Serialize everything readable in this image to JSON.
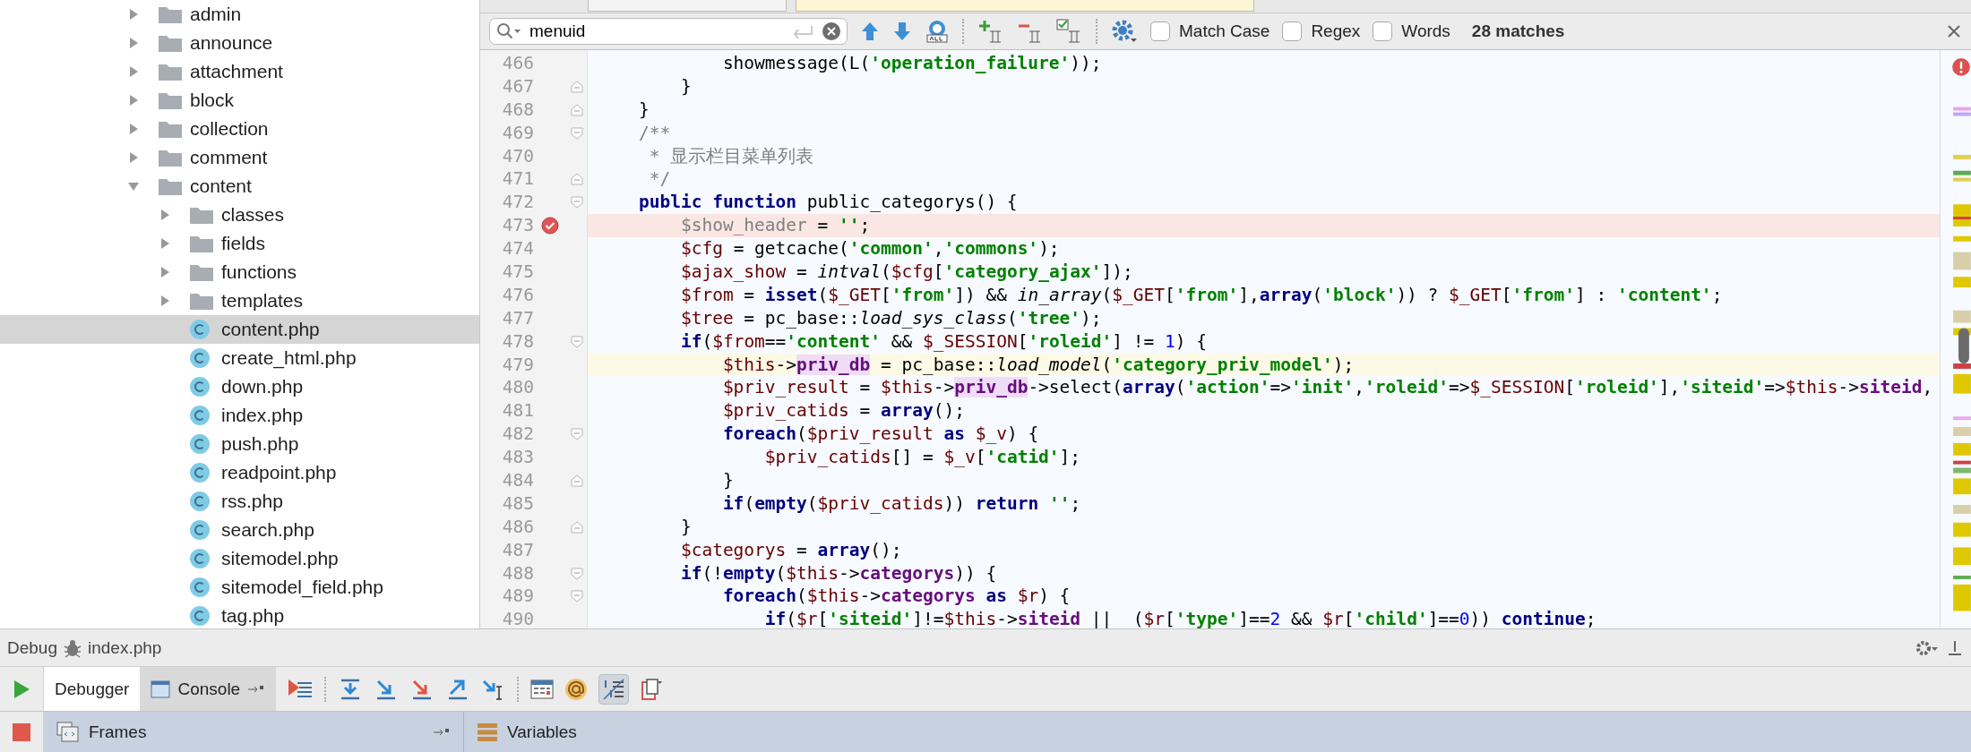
{
  "project_tree": [
    {
      "label": "admin",
      "kind": "folder",
      "expanded": false,
      "selected": false
    },
    {
      "label": "announce",
      "kind": "folder",
      "expanded": false,
      "selected": false
    },
    {
      "label": "attachment",
      "kind": "folder",
      "expanded": false,
      "selected": false
    },
    {
      "label": "block",
      "kind": "folder",
      "expanded": false,
      "selected": false
    },
    {
      "label": "collection",
      "kind": "folder",
      "expanded": false,
      "selected": false
    },
    {
      "label": "comment",
      "kind": "folder",
      "expanded": false,
      "selected": false
    },
    {
      "label": "content",
      "kind": "folder",
      "expanded": true,
      "selected": false,
      "children": [
        {
          "label": "classes",
          "kind": "folder",
          "expanded": false,
          "selected": false
        },
        {
          "label": "fields",
          "kind": "folder",
          "expanded": false,
          "selected": false
        },
        {
          "label": "functions",
          "kind": "folder",
          "expanded": false,
          "selected": false
        },
        {
          "label": "templates",
          "kind": "folder",
          "expanded": false,
          "selected": false
        },
        {
          "label": "content.php",
          "kind": "file",
          "selected": true
        },
        {
          "label": "create_html.php",
          "kind": "file",
          "selected": false
        },
        {
          "label": "down.php",
          "kind": "file",
          "selected": false
        },
        {
          "label": "index.php",
          "kind": "file",
          "selected": false
        },
        {
          "label": "push.php",
          "kind": "file",
          "selected": false
        },
        {
          "label": "readpoint.php",
          "kind": "file",
          "selected": false
        },
        {
          "label": "rss.php",
          "kind": "file",
          "selected": false
        },
        {
          "label": "search.php",
          "kind": "file",
          "selected": false
        },
        {
          "label": "sitemodel.php",
          "kind": "file",
          "selected": false
        },
        {
          "label": "sitemodel_field.php",
          "kind": "file",
          "selected": false
        },
        {
          "label": "tag.php",
          "kind": "file",
          "selected": false
        }
      ]
    }
  ],
  "search_bar": {
    "value": "menuid",
    "options": [
      {
        "label": "Match Case",
        "checked": false
      },
      {
        "label": "Regex",
        "checked": false
      },
      {
        "label": "Words",
        "checked": false
      }
    ],
    "matches": "28 matches"
  },
  "code_lines": [
    {
      "number": "466",
      "breakpoint": false,
      "execution_line": false,
      "fold_start": false,
      "fold_end": false,
      "tokens": [
        {
          "kind": "plain",
          "text": "            showmessage(L("
        },
        {
          "kind": "string",
          "text": "'operation_failure'"
        },
        {
          "kind": "plain",
          "text": "));"
        }
      ]
    },
    {
      "number": "467",
      "breakpoint": false,
      "execution_line": false,
      "fold_start": false,
      "fold_end": true,
      "tokens": [
        {
          "kind": "plain",
          "text": "        }"
        }
      ]
    },
    {
      "number": "468",
      "breakpoint": false,
      "execution_line": false,
      "fold_start": false,
      "fold_end": true,
      "tokens": [
        {
          "kind": "plain",
          "text": "    }"
        }
      ]
    },
    {
      "number": "469",
      "breakpoint": false,
      "execution_line": false,
      "fold_start": true,
      "fold_end": false,
      "tokens": [
        {
          "kind": "comment",
          "text": "    /**"
        }
      ]
    },
    {
      "number": "470",
      "breakpoint": false,
      "execution_line": false,
      "fold_start": false,
      "fold_end": false,
      "tokens": [
        {
          "kind": "comment",
          "text": "     * 显示栏目菜单列表"
        }
      ]
    },
    {
      "number": "471",
      "breakpoint": false,
      "execution_line": false,
      "fold_start": false,
      "fold_end": true,
      "tokens": [
        {
          "kind": "comment",
          "text": "     */"
        }
      ]
    },
    {
      "number": "472",
      "breakpoint": false,
      "execution_line": false,
      "fold_start": true,
      "fold_end": false,
      "tokens": [
        {
          "kind": "keyword",
          "text": "    public function "
        },
        {
          "kind": "plain",
          "text": "public_categorys() {"
        }
      ]
    },
    {
      "number": "473",
      "breakpoint": true,
      "execution_line": false,
      "fold_start": false,
      "fold_end": false,
      "tokens": [
        {
          "kind": "unused",
          "text": "        $show_header"
        },
        {
          "kind": "plain",
          "text": " = "
        },
        {
          "kind": "string",
          "text": "''"
        },
        {
          "kind": "plain",
          "text": ";"
        }
      ]
    },
    {
      "number": "474",
      "breakpoint": false,
      "execution_line": false,
      "fold_start": false,
      "fold_end": false,
      "tokens": [
        {
          "kind": "variable",
          "text": "        $cfg"
        },
        {
          "kind": "plain",
          "text": " = getcache("
        },
        {
          "kind": "string",
          "text": "'common'"
        },
        {
          "kind": "plain",
          "text": ","
        },
        {
          "kind": "string",
          "text": "'commons'"
        },
        {
          "kind": "plain",
          "text": ");"
        }
      ]
    },
    {
      "number": "475",
      "breakpoint": false,
      "execution_line": false,
      "fold_start": false,
      "fold_end": false,
      "tokens": [
        {
          "kind": "variable",
          "text": "        $ajax_show"
        },
        {
          "kind": "plain",
          "text": " = "
        },
        {
          "kind": "call",
          "text": "intval"
        },
        {
          "kind": "plain",
          "text": "("
        },
        {
          "kind": "variable",
          "text": "$cfg"
        },
        {
          "kind": "plain",
          "text": "["
        },
        {
          "kind": "string",
          "text": "'category_ajax'"
        },
        {
          "kind": "plain",
          "text": "]);"
        }
      ]
    },
    {
      "number": "476",
      "breakpoint": false,
      "execution_line": false,
      "fold_start": false,
      "fold_end": false,
      "tokens": [
        {
          "kind": "variable",
          "text": "        $from"
        },
        {
          "kind": "plain",
          "text": " = "
        },
        {
          "kind": "keyword",
          "text": "isset"
        },
        {
          "kind": "plain",
          "text": "("
        },
        {
          "kind": "variable",
          "text": "$_GET"
        },
        {
          "kind": "plain",
          "text": "["
        },
        {
          "kind": "string",
          "text": "'from'"
        },
        {
          "kind": "plain",
          "text": "]) && "
        },
        {
          "kind": "call",
          "text": "in_array"
        },
        {
          "kind": "plain",
          "text": "("
        },
        {
          "kind": "variable",
          "text": "$_GET"
        },
        {
          "kind": "plain",
          "text": "["
        },
        {
          "kind": "string",
          "text": "'from'"
        },
        {
          "kind": "plain",
          "text": "],"
        },
        {
          "kind": "keyword",
          "text": "array"
        },
        {
          "kind": "plain",
          "text": "("
        },
        {
          "kind": "string",
          "text": "'block'"
        },
        {
          "kind": "plain",
          "text": ")) ? "
        },
        {
          "kind": "variable",
          "text": "$_GET"
        },
        {
          "kind": "plain",
          "text": "["
        },
        {
          "kind": "string",
          "text": "'from'"
        },
        {
          "kind": "plain",
          "text": "] : "
        },
        {
          "kind": "string",
          "text": "'content'"
        },
        {
          "kind": "plain",
          "text": ";"
        }
      ]
    },
    {
      "number": "477",
      "breakpoint": false,
      "execution_line": false,
      "fold_start": false,
      "fold_end": false,
      "tokens": [
        {
          "kind": "variable",
          "text": "        $tree"
        },
        {
          "kind": "plain",
          "text": " = pc_base::"
        },
        {
          "kind": "call",
          "text": "load_sys_class"
        },
        {
          "kind": "plain",
          "text": "("
        },
        {
          "kind": "string",
          "text": "'tree'"
        },
        {
          "kind": "plain",
          "text": ");"
        }
      ]
    },
    {
      "number": "478",
      "breakpoint": false,
      "execution_line": false,
      "fold_start": true,
      "fold_end": false,
      "tokens": [
        {
          "kind": "keyword",
          "text": "        if"
        },
        {
          "kind": "plain",
          "text": "("
        },
        {
          "kind": "variable",
          "text": "$from"
        },
        {
          "kind": "plain",
          "text": "=="
        },
        {
          "kind": "string",
          "text": "'content'"
        },
        {
          "kind": "plain",
          "text": " && "
        },
        {
          "kind": "variable",
          "text": "$_SESSION"
        },
        {
          "kind": "plain",
          "text": "["
        },
        {
          "kind": "string",
          "text": "'roleid'"
        },
        {
          "kind": "plain",
          "text": "] != "
        },
        {
          "kind": "number",
          "text": "1"
        },
        {
          "kind": "plain",
          "text": ") {"
        }
      ]
    },
    {
      "number": "479",
      "breakpoint": false,
      "execution_line": true,
      "fold_start": false,
      "fold_end": false,
      "tokens": [
        {
          "kind": "variable",
          "text": "            $this"
        },
        {
          "kind": "plain",
          "text": "->"
        },
        {
          "kind": "marked_field",
          "text": "priv_db"
        },
        {
          "kind": "plain",
          "text": " = pc_base::"
        },
        {
          "kind": "call",
          "text": "load_model"
        },
        {
          "kind": "plain",
          "text": "("
        },
        {
          "kind": "string",
          "text": "'category_priv_model'"
        },
        {
          "kind": "plain",
          "text": ");"
        }
      ]
    },
    {
      "number": "480",
      "breakpoint": false,
      "execution_line": false,
      "fold_start": false,
      "fold_end": false,
      "tokens": [
        {
          "kind": "variable",
          "text": "            $priv_result"
        },
        {
          "kind": "plain",
          "text": " = "
        },
        {
          "kind": "variable",
          "text": "$this"
        },
        {
          "kind": "plain",
          "text": "->"
        },
        {
          "kind": "marked_field",
          "text": "priv_db"
        },
        {
          "kind": "plain",
          "text": "->select("
        },
        {
          "kind": "keyword",
          "text": "array"
        },
        {
          "kind": "plain",
          "text": "("
        },
        {
          "kind": "string",
          "text": "'action'"
        },
        {
          "kind": "plain",
          "text": "=>"
        },
        {
          "kind": "string",
          "text": "'init'"
        },
        {
          "kind": "plain",
          "text": ","
        },
        {
          "kind": "string",
          "text": "'roleid'"
        },
        {
          "kind": "plain",
          "text": "=>"
        },
        {
          "kind": "variable",
          "text": "$_SESSION"
        },
        {
          "kind": "plain",
          "text": "["
        },
        {
          "kind": "string",
          "text": "'roleid'"
        },
        {
          "kind": "plain",
          "text": "],"
        },
        {
          "kind": "string",
          "text": "'siteid'"
        },
        {
          "kind": "plain",
          "text": "=>"
        },
        {
          "kind": "variable",
          "text": "$this"
        },
        {
          "kind": "plain",
          "text": "->"
        },
        {
          "kind": "field",
          "text": "siteid"
        },
        {
          "kind": "plain",
          "text": ","
        }
      ]
    },
    {
      "number": "481",
      "breakpoint": false,
      "execution_line": false,
      "fold_start": false,
      "fold_end": false,
      "tokens": [
        {
          "kind": "variable",
          "text": "            $priv_catids"
        },
        {
          "kind": "plain",
          "text": " = "
        },
        {
          "kind": "keyword",
          "text": "array"
        },
        {
          "kind": "plain",
          "text": "();"
        }
      ]
    },
    {
      "number": "482",
      "breakpoint": false,
      "execution_line": false,
      "fold_start": true,
      "fold_end": false,
      "tokens": [
        {
          "kind": "keyword",
          "text": "            foreach"
        },
        {
          "kind": "plain",
          "text": "("
        },
        {
          "kind": "variable",
          "text": "$priv_result"
        },
        {
          "kind": "keyword",
          "text": " as "
        },
        {
          "kind": "variable",
          "text": "$_v"
        },
        {
          "kind": "plain",
          "text": ") {"
        }
      ]
    },
    {
      "number": "483",
      "breakpoint": false,
      "execution_line": false,
      "fold_start": false,
      "fold_end": false,
      "tokens": [
        {
          "kind": "variable",
          "text": "                $priv_catids"
        },
        {
          "kind": "plain",
          "text": "[] = "
        },
        {
          "kind": "variable",
          "text": "$_v"
        },
        {
          "kind": "plain",
          "text": "["
        },
        {
          "kind": "string",
          "text": "'catid'"
        },
        {
          "kind": "plain",
          "text": "];"
        }
      ]
    },
    {
      "number": "484",
      "breakpoint": false,
      "execution_line": false,
      "fold_start": false,
      "fold_end": true,
      "tokens": [
        {
          "kind": "plain",
          "text": "            }"
        }
      ]
    },
    {
      "number": "485",
      "breakpoint": false,
      "execution_line": false,
      "fold_start": false,
      "fold_end": false,
      "tokens": [
        {
          "kind": "keyword",
          "text": "            if"
        },
        {
          "kind": "plain",
          "text": "("
        },
        {
          "kind": "keyword",
          "text": "empty"
        },
        {
          "kind": "plain",
          "text": "("
        },
        {
          "kind": "variable",
          "text": "$priv_catids"
        },
        {
          "kind": "plain",
          "text": ")) "
        },
        {
          "kind": "keyword",
          "text": "return"
        },
        {
          "kind": "string",
          "text": " ''"
        },
        {
          "kind": "plain",
          "text": ";"
        }
      ]
    },
    {
      "number": "486",
      "breakpoint": false,
      "execution_line": false,
      "fold_start": false,
      "fold_end": true,
      "tokens": [
        {
          "kind": "plain",
          "text": "        }"
        }
      ]
    },
    {
      "number": "487",
      "breakpoint": false,
      "execution_line": false,
      "fold_start": false,
      "fold_end": false,
      "tokens": [
        {
          "kind": "variable",
          "text": "        $categorys"
        },
        {
          "kind": "plain",
          "text": " = "
        },
        {
          "kind": "keyword",
          "text": "array"
        },
        {
          "kind": "plain",
          "text": "();"
        }
      ]
    },
    {
      "number": "488",
      "breakpoint": false,
      "execution_line": false,
      "fold_start": true,
      "fold_end": false,
      "tokens": [
        {
          "kind": "keyword",
          "text": "        if"
        },
        {
          "kind": "plain",
          "text": "(!"
        },
        {
          "kind": "keyword",
          "text": "empty"
        },
        {
          "kind": "plain",
          "text": "("
        },
        {
          "kind": "variable",
          "text": "$this"
        },
        {
          "kind": "plain",
          "text": "->"
        },
        {
          "kind": "field",
          "text": "categorys"
        },
        {
          "kind": "plain",
          "text": ")) {"
        }
      ]
    },
    {
      "number": "489",
      "breakpoint": false,
      "execution_line": false,
      "fold_start": true,
      "fold_end": false,
      "tokens": [
        {
          "kind": "keyword",
          "text": "            foreach"
        },
        {
          "kind": "plain",
          "text": "("
        },
        {
          "kind": "variable",
          "text": "$this"
        },
        {
          "kind": "plain",
          "text": "->"
        },
        {
          "kind": "field",
          "text": "categorys"
        },
        {
          "kind": "keyword",
          "text": " as "
        },
        {
          "kind": "variable",
          "text": "$r"
        },
        {
          "kind": "plain",
          "text": ") {"
        }
      ]
    },
    {
      "number": "490",
      "breakpoint": false,
      "execution_line": false,
      "fold_start": false,
      "fold_end": false,
      "tokens": [
        {
          "kind": "keyword",
          "text": "                if"
        },
        {
          "kind": "plain",
          "text": "("
        },
        {
          "kind": "variable",
          "text": "$r"
        },
        {
          "kind": "plain",
          "text": "["
        },
        {
          "kind": "string",
          "text": "'siteid'"
        },
        {
          "kind": "plain",
          "text": "]!="
        },
        {
          "kind": "variable",
          "text": "$this"
        },
        {
          "kind": "plain",
          "text": "->"
        },
        {
          "kind": "field",
          "text": "siteid"
        },
        {
          "kind": "plain",
          "text": " ||  ("
        },
        {
          "kind": "variable",
          "text": "$r"
        },
        {
          "kind": "plain",
          "text": "["
        },
        {
          "kind": "string",
          "text": "'type'"
        },
        {
          "kind": "plain",
          "text": "]=="
        },
        {
          "kind": "number",
          "text": "2"
        },
        {
          "kind": "plain",
          "text": " && "
        },
        {
          "kind": "variable",
          "text": "$r"
        },
        {
          "kind": "plain",
          "text": "["
        },
        {
          "kind": "string",
          "text": "'child'"
        },
        {
          "kind": "plain",
          "text": "]=="
        },
        {
          "kind": "number",
          "text": "0"
        },
        {
          "kind": "plain",
          "text": ")) "
        },
        {
          "kind": "keyword",
          "text": "continue"
        },
        {
          "kind": "plain",
          "text": ";"
        }
      ]
    }
  ],
  "debug_panel": {
    "title": "Debug",
    "config": "index.php",
    "tabs": [
      {
        "label": "Debugger",
        "selected": true
      },
      {
        "label": "Console",
        "selected": false
      }
    ],
    "list_toggle_on": true,
    "frames_label": "Frames",
    "variables_label": "Variables"
  }
}
